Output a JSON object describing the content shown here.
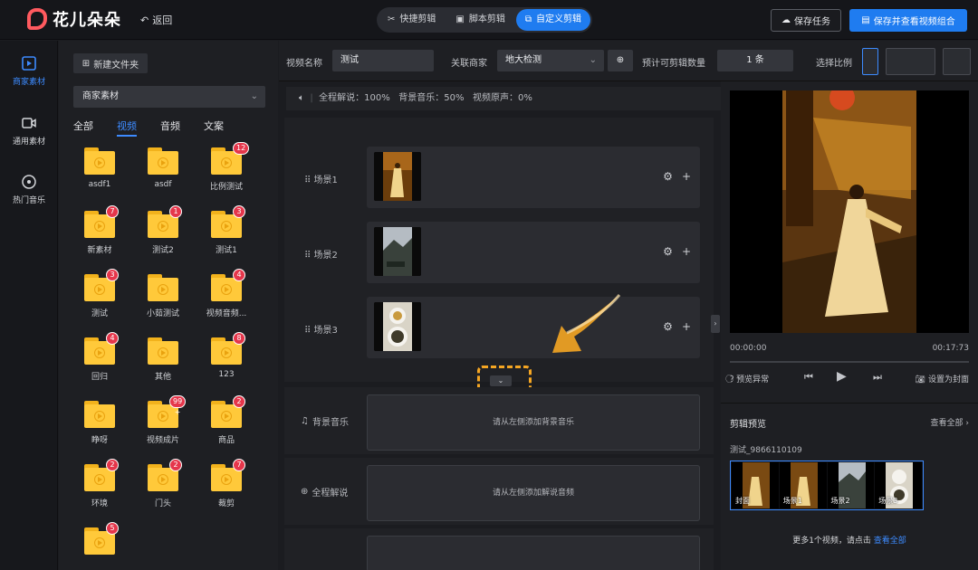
{
  "app": {
    "logo_text": "花儿朵朵",
    "back_label": "返回",
    "brand_color": "#ff5a5f",
    "accent_color": "#1f7cf0"
  },
  "modes": [
    {
      "label": "快捷剪辑",
      "icon": "scissors-icon",
      "active": false
    },
    {
      "label": "脚本剪辑",
      "icon": "film-icon",
      "active": false
    },
    {
      "label": "自定义剪辑",
      "icon": "custom-edit-icon",
      "active": true
    }
  ],
  "actions": {
    "save_task": "保存任务",
    "save_and_view": "保存并查看视频组合"
  },
  "nav": [
    {
      "label": "商家素材",
      "icon": "merchant-material-icon",
      "active": true
    },
    {
      "label": "通用素材",
      "icon": "video-camera-icon",
      "active": false
    },
    {
      "label": "热门音乐",
      "icon": "music-disc-icon",
      "active": false
    }
  ],
  "materials": {
    "new_folder": "新建文件夹",
    "selected_source": "商家素材",
    "tabs": [
      "全部",
      "视频",
      "音频",
      "文案"
    ],
    "active_tab": "视频",
    "folders": [
      {
        "label": "asdf1",
        "badge": ""
      },
      {
        "label": "asdf",
        "badge": ""
      },
      {
        "label": "比例测试",
        "badge": "12"
      },
      {
        "label": "新素材",
        "badge": "7"
      },
      {
        "label": "测试2",
        "badge": "1"
      },
      {
        "label": "测试1",
        "badge": "3"
      },
      {
        "label": "测试",
        "badge": "3"
      },
      {
        "label": "小茹测试",
        "badge": ""
      },
      {
        "label": "视频音频...",
        "badge": "4"
      },
      {
        "label": "回归",
        "badge": "4"
      },
      {
        "label": "其他",
        "badge": ""
      },
      {
        "label": "123",
        "badge": "8"
      },
      {
        "label": "睁呀",
        "badge": ""
      },
      {
        "label": "视频成片",
        "badge": "99 +"
      },
      {
        "label": "商品",
        "badge": "2"
      },
      {
        "label": "环境",
        "badge": "2"
      },
      {
        "label": "门头",
        "badge": "2"
      },
      {
        "label": "裁剪",
        "badge": "7"
      },
      {
        "label": "",
        "badge": "5"
      }
    ]
  },
  "form": {
    "video_name_label": "视频名称",
    "video_name_value": "测试",
    "merchant_label": "关联商家",
    "merchant_value": "地大检测",
    "estimate_label": "预计可剪辑数量",
    "estimate_value": "1 条",
    "ratio_label": "选择比例"
  },
  "editor": {
    "status_text": "全程解说：100%   背景音乐：50%   视频原声：0%",
    "scenes": [
      {
        "label": "场景1",
        "thumb": "dancer"
      },
      {
        "label": "场景2",
        "thumb": "mountain"
      },
      {
        "label": "场景3",
        "thumb": "food"
      }
    ],
    "tracks": [
      {
        "label": "背景音乐",
        "icon": "music-note-icon",
        "placeholder": "请从左侧添加背景音乐"
      },
      {
        "label": "全程解说",
        "icon": "add-circle-icon",
        "placeholder": "请从左侧添加解说音频"
      }
    ]
  },
  "preview": {
    "time_start": "00:00:00",
    "time_end": "00:17:73",
    "preview_issue": "预览异常",
    "set_cover": "设置为封面",
    "section_title": "剪辑预览",
    "view_all": "查看全部 ›",
    "clip_name": "测试_9866110109",
    "clip_frames": [
      "封面",
      "场景1",
      "场景2",
      "场景3"
    ],
    "more_prefix": "更多1个视频，请点击",
    "more_link": "查看全部"
  }
}
